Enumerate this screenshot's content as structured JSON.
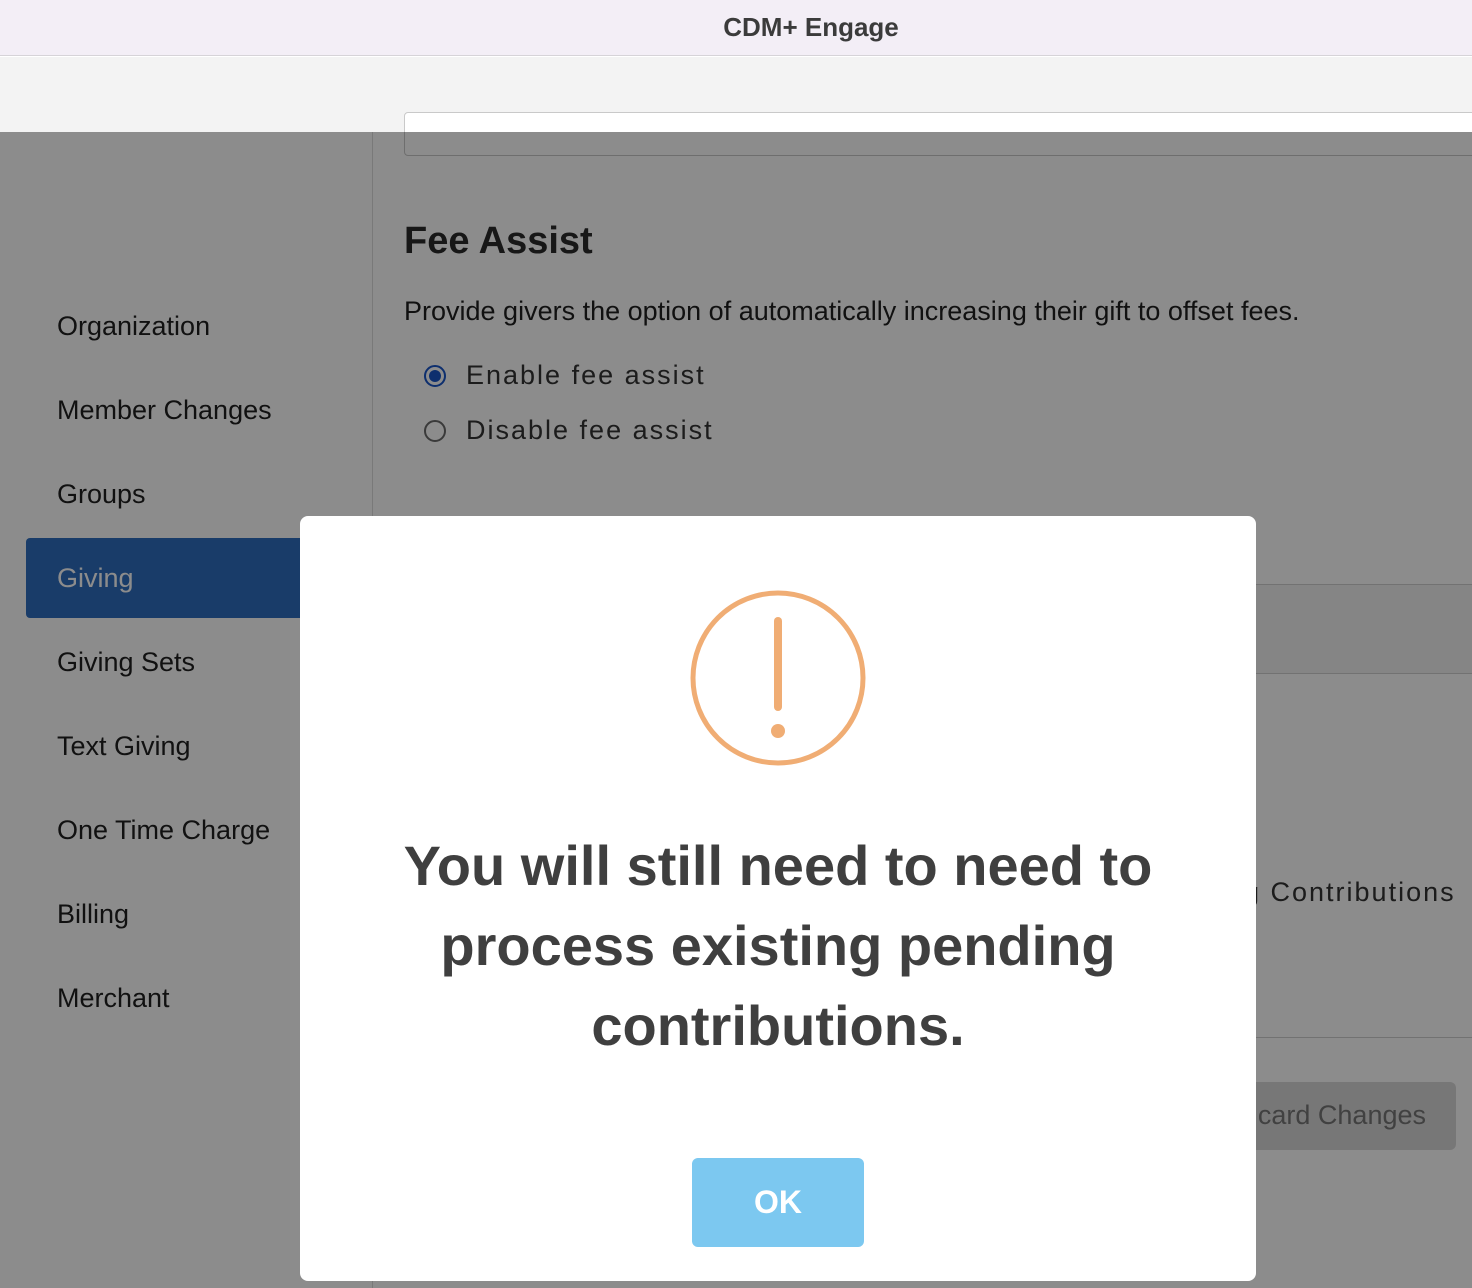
{
  "window": {
    "title": "CDM+ Engage"
  },
  "sidebar": {
    "items": [
      {
        "label": "Organization",
        "active": false
      },
      {
        "label": "Member Changes",
        "active": false
      },
      {
        "label": "Groups",
        "active": false
      },
      {
        "label": "Giving",
        "active": true
      },
      {
        "label": "Giving Sets",
        "active": false
      },
      {
        "label": "Text Giving",
        "active": false
      },
      {
        "label": "One Time Charge",
        "active": false
      },
      {
        "label": "Billing",
        "active": false
      },
      {
        "label": "Merchant",
        "active": false
      }
    ]
  },
  "main": {
    "fee_assist": {
      "title": "Fee Assist",
      "description": "Provide givers the option of automatically increasing their gift to offset fees.",
      "options": [
        {
          "label": "Enable fee assist",
          "checked": true
        },
        {
          "label": "Disable fee assist",
          "checked": false
        }
      ]
    },
    "partial_option_text": "g Contributions",
    "discard_button_label": "card Changes"
  },
  "modal": {
    "icon": "exclamation-circle-icon",
    "icon_color": "#f0ad74",
    "message": "You will still need to need to process existing pending contributions.",
    "ok_label": "OK",
    "ok_color": "#7cc8f0"
  },
  "colors": {
    "accent": "#2e6dc0",
    "radio_selected": "#1a56c9"
  }
}
